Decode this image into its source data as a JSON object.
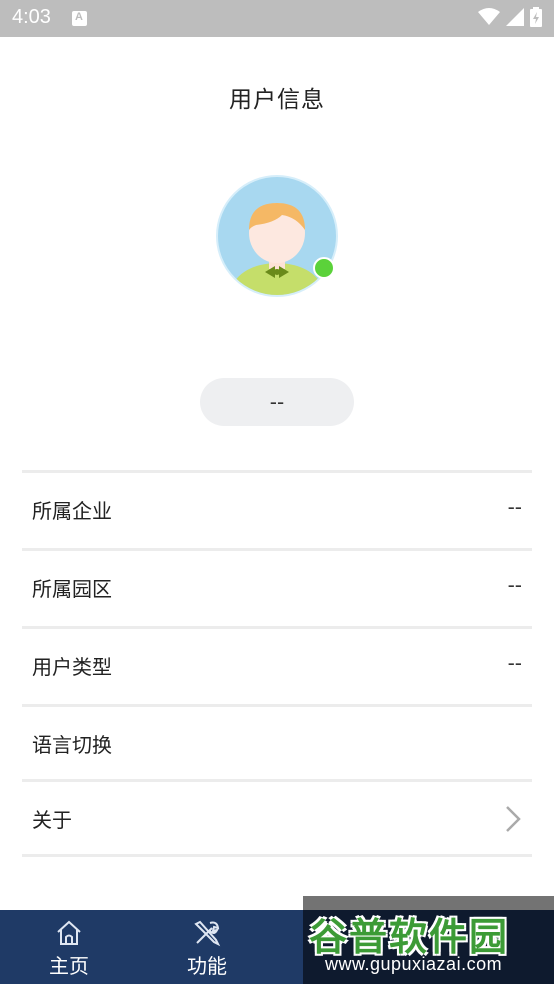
{
  "status_bar": {
    "time": "4:03",
    "icons": [
      "notification-a-icon",
      "wifi-icon",
      "signal-icon",
      "battery-icon"
    ]
  },
  "header": {
    "title": "用户信息"
  },
  "profile": {
    "name": "--",
    "online": true,
    "status_color": "#5bd23a"
  },
  "info_rows": [
    {
      "label": "所属企业",
      "value": "--"
    },
    {
      "label": "所属园区",
      "value": "--"
    },
    {
      "label": "用户类型",
      "value": "--"
    },
    {
      "label": "语言切换",
      "value": ""
    },
    {
      "label": "关于",
      "value": ""
    }
  ],
  "bottom_nav": {
    "items": [
      {
        "label": "主页",
        "icon": "home-icon"
      },
      {
        "label": "功能",
        "icon": "tools-icon"
      }
    ],
    "background_color": "#1f3a66"
  },
  "watermark": {
    "title": "谷普软件园",
    "url": "www.gupuxiazai.com"
  }
}
